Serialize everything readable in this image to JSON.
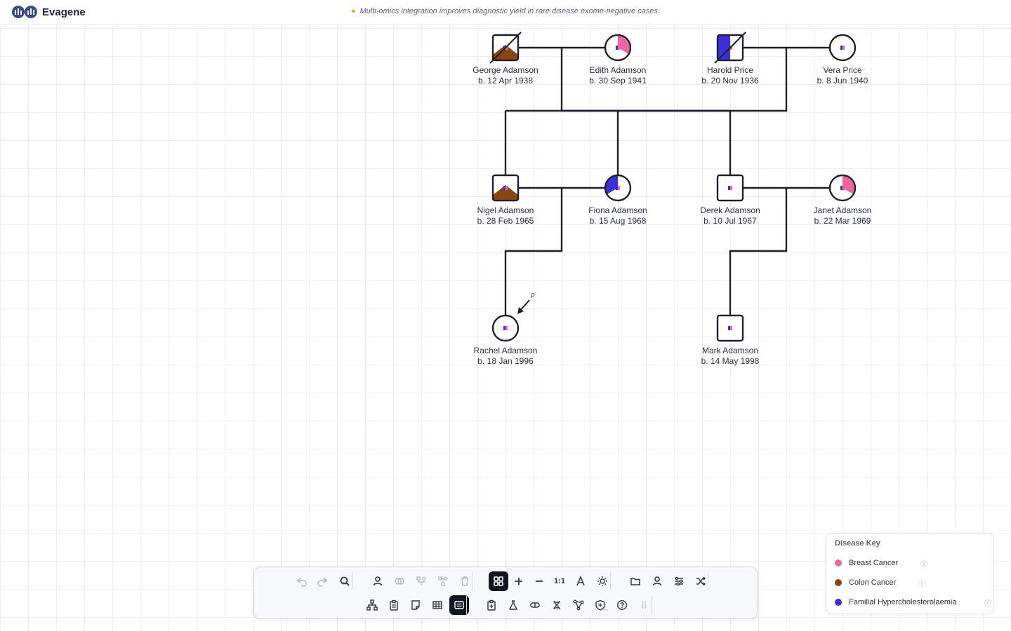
{
  "app": {
    "title": "Evagene"
  },
  "tip": {
    "text": "Multi-omics integration improves diagnostic yield in rare disease exome-negative cases."
  },
  "colors": {
    "breast_cancer": "#f0649f",
    "colon_cancer": "#8b4513",
    "familial_hypercholesterolaemia": "#3a2fd9",
    "line": "#1b1f2a"
  },
  "individuals": [
    {
      "id": "george",
      "name": "George Adamson",
      "dob": "b. 12 Apr 1938",
      "sex": "male",
      "deceased": true,
      "affections": [
        "colon_cancer"
      ]
    },
    {
      "id": "edith",
      "name": "Edith Adamson",
      "dob": "b. 30 Sep 1941",
      "sex": "female",
      "deceased": false,
      "affections": [
        "breast_cancer"
      ]
    },
    {
      "id": "harold",
      "name": "Harold Price",
      "dob": "b. 20 Nov 1936",
      "sex": "male",
      "deceased": true,
      "affections": [
        "familial_hypercholesterolaemia"
      ]
    },
    {
      "id": "vera",
      "name": "Vera Price",
      "dob": "b. 8 Jun 1940",
      "sex": "female",
      "deceased": false,
      "affections": []
    },
    {
      "id": "nigel",
      "name": "Nigel Adamson",
      "dob": "b. 28 Feb 1965",
      "sex": "male",
      "deceased": false,
      "affections": [
        "colon_cancer"
      ]
    },
    {
      "id": "fiona",
      "name": "Fiona Adamson",
      "dob": "b. 15 Aug 1968",
      "sex": "female",
      "deceased": false,
      "affections": [
        "familial_hypercholesterolaemia"
      ]
    },
    {
      "id": "derek",
      "name": "Derek Adamson",
      "dob": "b. 10 Jul 1967",
      "sex": "male",
      "deceased": false,
      "affections": []
    },
    {
      "id": "janet",
      "name": "Janet Adamson",
      "dob": "b. 22 Mar 1969",
      "sex": "female",
      "deceased": false,
      "affections": [
        "breast_cancer"
      ]
    },
    {
      "id": "rachel",
      "name": "Rachel Adamson",
      "dob": "b. 18 Jan 1996",
      "sex": "female",
      "deceased": false,
      "affections": [],
      "proband": true
    },
    {
      "id": "mark",
      "name": "Mark Adamson",
      "dob": "b. 14 May 1998",
      "sex": "male",
      "deceased": false,
      "affections": []
    }
  ],
  "proband_label": "P",
  "toolbar": {
    "row1": [
      {
        "name": "undo-button",
        "icon": "undo",
        "disabled": true
      },
      {
        "name": "redo-button",
        "icon": "redo",
        "disabled": true
      },
      {
        "name": "search-button",
        "icon": "search"
      },
      {
        "name": "add-individual-button",
        "icon": "person"
      },
      {
        "name": "add-partner-button",
        "icon": "rings",
        "disabled": true
      },
      {
        "name": "add-children-button",
        "icon": "children",
        "disabled": true
      },
      {
        "name": "add-parents-button",
        "icon": "parents",
        "disabled": true
      },
      {
        "name": "delete-button",
        "icon": "trash",
        "disabled": true
      },
      {
        "name": "fit-view-button",
        "icon": "grid",
        "active": true
      },
      {
        "name": "zoom-in-button",
        "icon": "plus"
      },
      {
        "name": "zoom-out-button",
        "icon": "minus"
      },
      {
        "name": "zoom-reset-button",
        "icon": "text",
        "label": "1:1"
      },
      {
        "name": "font-size-button",
        "icon": "font"
      },
      {
        "name": "theme-button",
        "icon": "sun"
      },
      {
        "name": "open-file-button",
        "icon": "folder"
      },
      {
        "name": "profile-button",
        "icon": "person"
      },
      {
        "name": "settings-button",
        "icon": "sliders"
      },
      {
        "name": "shuffle-layout-button",
        "icon": "shuffle"
      }
    ],
    "row2": [
      {
        "name": "tree-view-button",
        "icon": "tree"
      },
      {
        "name": "clipboard-button",
        "icon": "clipboard"
      },
      {
        "name": "notes-button",
        "icon": "note"
      },
      {
        "name": "table-view-button",
        "icon": "table"
      },
      {
        "name": "list-view-button",
        "icon": "list",
        "active": true
      },
      {
        "name": "clinical-record-button",
        "icon": "clipadd"
      },
      {
        "name": "lab-tests-button",
        "icon": "flask"
      },
      {
        "name": "medication-button",
        "icon": "pill"
      },
      {
        "name": "genetics-button",
        "icon": "dna"
      },
      {
        "name": "network-button",
        "icon": "network"
      },
      {
        "name": "risk-button",
        "icon": "shield"
      },
      {
        "name": "help-button",
        "icon": "help"
      },
      {
        "name": "drag-handle",
        "icon": "grip",
        "disabled": true
      }
    ]
  },
  "legend": {
    "title": "Disease Key",
    "items": [
      {
        "label": "Breast Cancer",
        "color": "#f0649f"
      },
      {
        "label": "Colon Cancer",
        "color": "#8b4513"
      },
      {
        "label": "Familial Hypercholesterolaemia",
        "color": "#3a2fd9"
      }
    ]
  }
}
